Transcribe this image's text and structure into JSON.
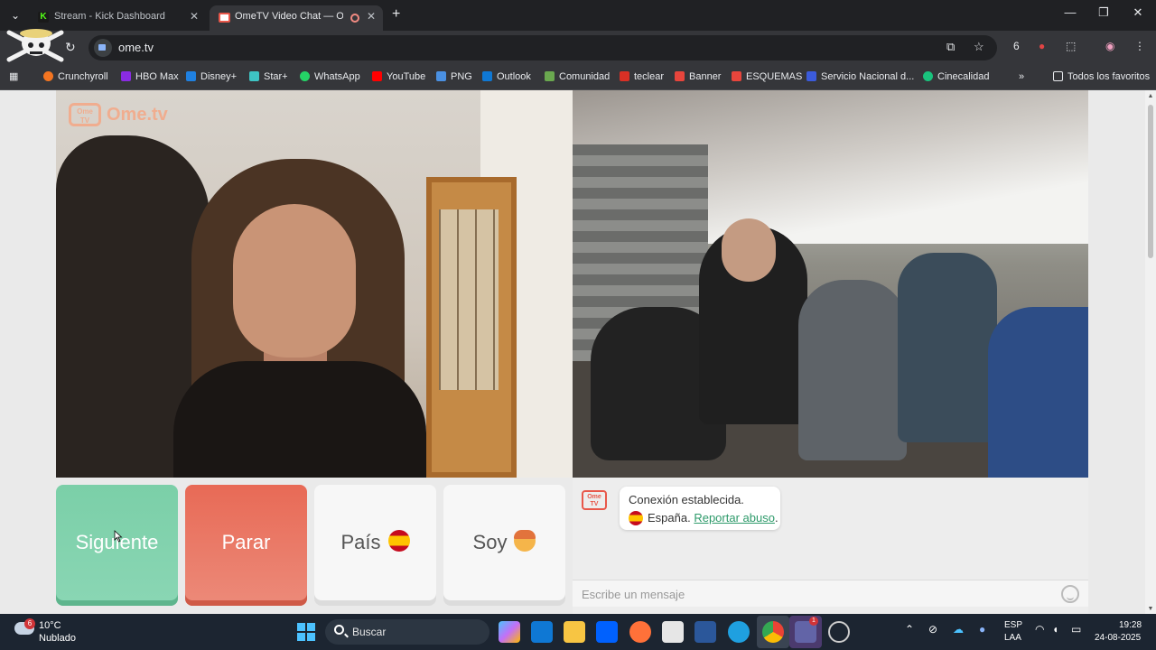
{
  "browser": {
    "tabs": [
      {
        "title": "Stream - Kick Dashboard",
        "favicon": "kick-icon"
      },
      {
        "title": "OmeTV Video Chat — Ome",
        "favicon": "ometv-icon",
        "active": true
      }
    ],
    "url": "ome.tv",
    "extension_badge": "6",
    "bookmarks": [
      {
        "label": "Crunchyroll",
        "color": "#f47521"
      },
      {
        "label": "HBO Max",
        "color": "#8a2be2"
      },
      {
        "label": "Disney+",
        "color": "#1f80e0"
      },
      {
        "label": "Star+",
        "color": "#3ec4c4"
      },
      {
        "label": "WhatsApp",
        "color": "#25d366"
      },
      {
        "label": "YouTube",
        "color": "#ff0000"
      },
      {
        "label": "PNG",
        "color": "#4a90e2"
      },
      {
        "label": "Outlook",
        "color": "#0f78d4"
      },
      {
        "label": "Comunidad",
        "color": "#6aa84f"
      },
      {
        "label": "teclear",
        "color": "#d93025"
      },
      {
        "label": "Banner",
        "color": "#e8453c"
      },
      {
        "label": "ESQUEMAS",
        "color": "#e8453c"
      },
      {
        "label": "Servicio Nacional d...",
        "color": "#3b5bdb"
      },
      {
        "label": "Cinecalidad",
        "color": "#19c37d"
      }
    ],
    "more_label": "»",
    "all_bookmarks_label": "Todos los favoritos"
  },
  "ometv": {
    "logo_text": "Ome.tv",
    "logo_badge": "Ome\nTV",
    "buttons": {
      "next": "Siguiente",
      "stop": "Parar",
      "country": "País",
      "gender": "Soy"
    },
    "chat": {
      "status": "Conexión establecida.",
      "country": "España.",
      "report_link": "Reportar abuso",
      "report_suffix": ".",
      "input_placeholder": "Escribe un mensaje"
    }
  },
  "taskbar": {
    "weather_temp": "10°C",
    "weather_desc": "Nublado",
    "weather_badge": "6",
    "search_label": "Buscar",
    "teams_badge": "1",
    "lang_line1": "ESP",
    "lang_line2": "LAA",
    "time": "19:28",
    "date": "24-08-2025"
  },
  "colors": {
    "next_button": "#7bcfa8",
    "stop_button": "#e86a56",
    "link": "#2d9a6a",
    "brand_orange": "#f0ad8f"
  }
}
